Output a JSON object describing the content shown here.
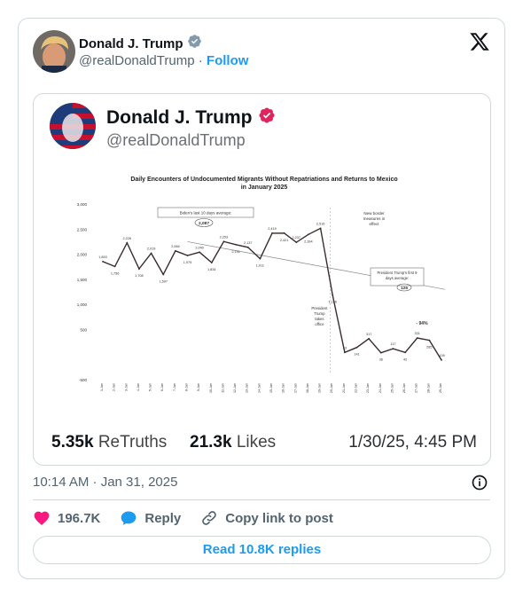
{
  "post": {
    "author_name": "Donald J. Trump",
    "handle": "@realDonaldTrump",
    "separator": "·",
    "follow_label": "Follow",
    "timestamp": "10:14 AM · Jan 31, 2025"
  },
  "embedded": {
    "name": "Donald J. Trump",
    "handle": "@realDonaldTrump",
    "retruths_value": "5.35k",
    "retruths_label": "ReTruths",
    "likes_value": "21.3k",
    "likes_label": "Likes",
    "posted": "1/30/25, 4:45 PM"
  },
  "actions": {
    "likes_count": "196.7K",
    "reply_label": "Reply",
    "copy_label": "Copy link to post",
    "read_replies_label": "Read 10.8K replies"
  },
  "colors": {
    "accent": "#1d9bf0",
    "like": "#f91880",
    "verified": "#829aab",
    "truth_badge": "#e0245e"
  },
  "chart_data": {
    "type": "line",
    "title_line1": "Daily Encounters of Undocumented Migrants Without Repatriations and Returns to Mexico",
    "title_line2": "in January 2025",
    "ylim": [
      -500,
      3000
    ],
    "yticks": [
      "3,000",
      "2,500",
      "2,000",
      "1,500",
      "1,000",
      "500",
      "",
      "-500"
    ],
    "categories": [
      "1-Jan",
      "2-Jan",
      "3-Jan",
      "4-Jan",
      "5-Jan",
      "6-Jan",
      "7-Jan",
      "8-Jan",
      "9-Jan",
      "10-Jan",
      "11-Jan",
      "12-Jan",
      "13-Jan",
      "14-Jan",
      "15-Jan",
      "16-Jan",
      "17-Jan",
      "18-Jan",
      "19-Jan",
      "20-Jan",
      "21-Jan",
      "22-Jan",
      "23-Jan",
      "24-Jan",
      "25-Jan",
      "26-Jan",
      "27-Jan",
      "28-Jan",
      "29-Jan"
    ],
    "values": [
      1853,
      1756,
      2226,
      1708,
      2019,
      1597,
      2066,
      1975,
      2040,
      1834,
      2253,
      2191,
      2137,
      1911,
      2419,
      2421,
      2237,
      2394,
      2516,
      1186,
      43,
      141,
      317,
      36,
      117,
      42,
      331,
      285,
      -109
    ],
    "data_labels": [
      "1,853",
      "1,756",
      "2,226",
      "1,708",
      "2,019",
      "1,597",
      "2,066",
      "1,975",
      "2,040",
      "1,834",
      "2,253",
      "2,191",
      "2,137",
      "1,911",
      "2,419",
      "2,421",
      "2,237",
      "2,394",
      "2,516",
      "1,186",
      "43",
      "141",
      "317",
      "36",
      "117",
      "42",
      "331",
      "285",
      "-109"
    ],
    "annotations": {
      "biden_avg_label": "Biden's last 10 days average:",
      "biden_avg_value": "2,087",
      "new_border": "New border measures in effect",
      "trump_avg_label": "President Trump's first 9 days average:",
      "trump_avg_value": "126",
      "takes_office": "President Trump takes office",
      "pct_change": "- 94%"
    }
  }
}
